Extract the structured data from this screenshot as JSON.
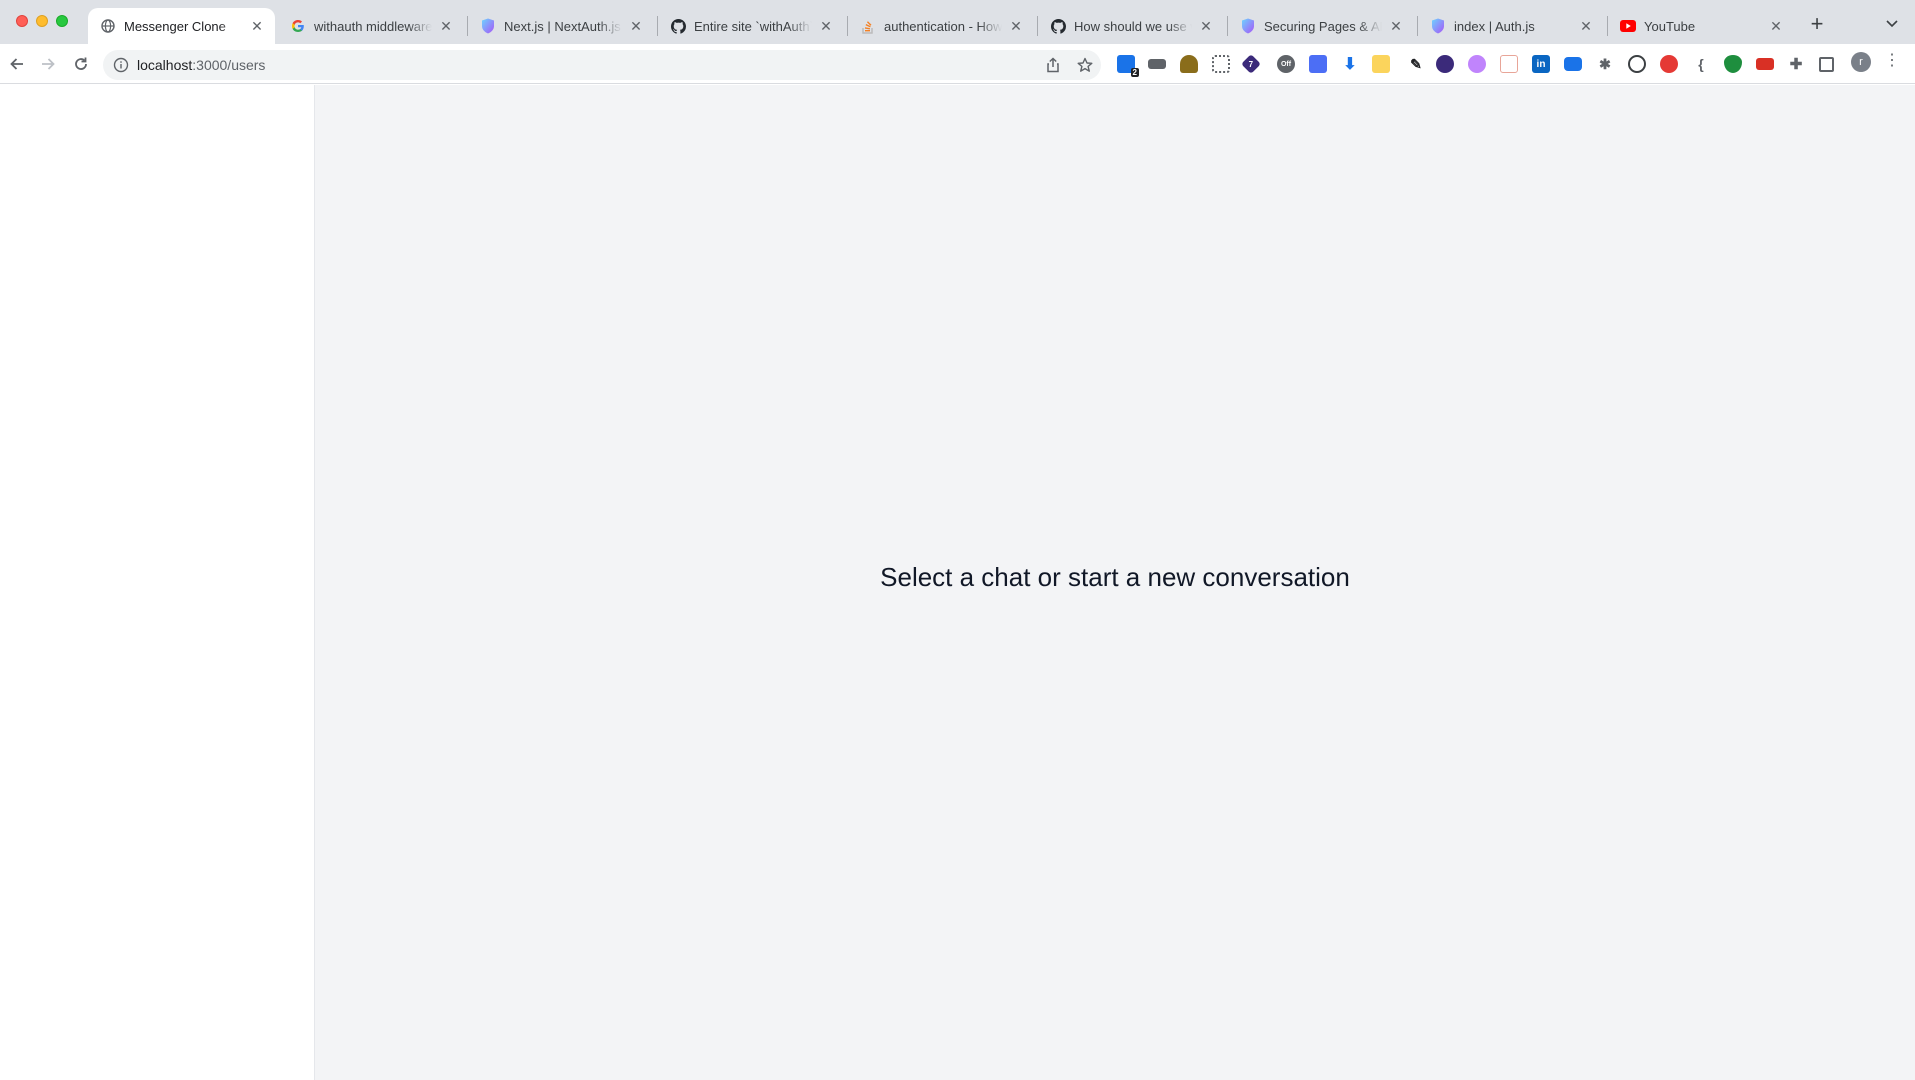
{
  "tabs": [
    {
      "title": "Messenger Clone",
      "favicon": "globe-icon",
      "active": true
    },
    {
      "title": "withauth middleware",
      "favicon": "google-icon",
      "active": false
    },
    {
      "title": "Next.js | NextAuth.js",
      "favicon": "nextauth-shield-icon",
      "active": false
    },
    {
      "title": "Entire site `withAuth`",
      "favicon": "github-icon",
      "active": false
    },
    {
      "title": "authentication - How",
      "favicon": "stackoverflow-icon",
      "active": false
    },
    {
      "title": "How should we use w",
      "favicon": "github-icon",
      "active": false
    },
    {
      "title": "Securing Pages & API",
      "favicon": "nextauth-shield-icon",
      "active": false
    },
    {
      "title": "index | Auth.js",
      "favicon": "nextauth-shield-icon",
      "active": false
    },
    {
      "title": "YouTube",
      "favicon": "youtube-icon",
      "active": false
    }
  ],
  "address_bar": {
    "host": "localhost",
    "path": ":3000/users"
  },
  "extension_badges": {
    "first": "2",
    "sixth": "7",
    "seventh": "Off",
    "avatar": "r"
  },
  "main": {
    "empty_state": "Select a chat or start a new conversation"
  },
  "colors": {
    "sidebar_bg": "#ffffff",
    "main_bg": "#f3f4f6",
    "tabstrip_bg": "#dee1e6"
  }
}
